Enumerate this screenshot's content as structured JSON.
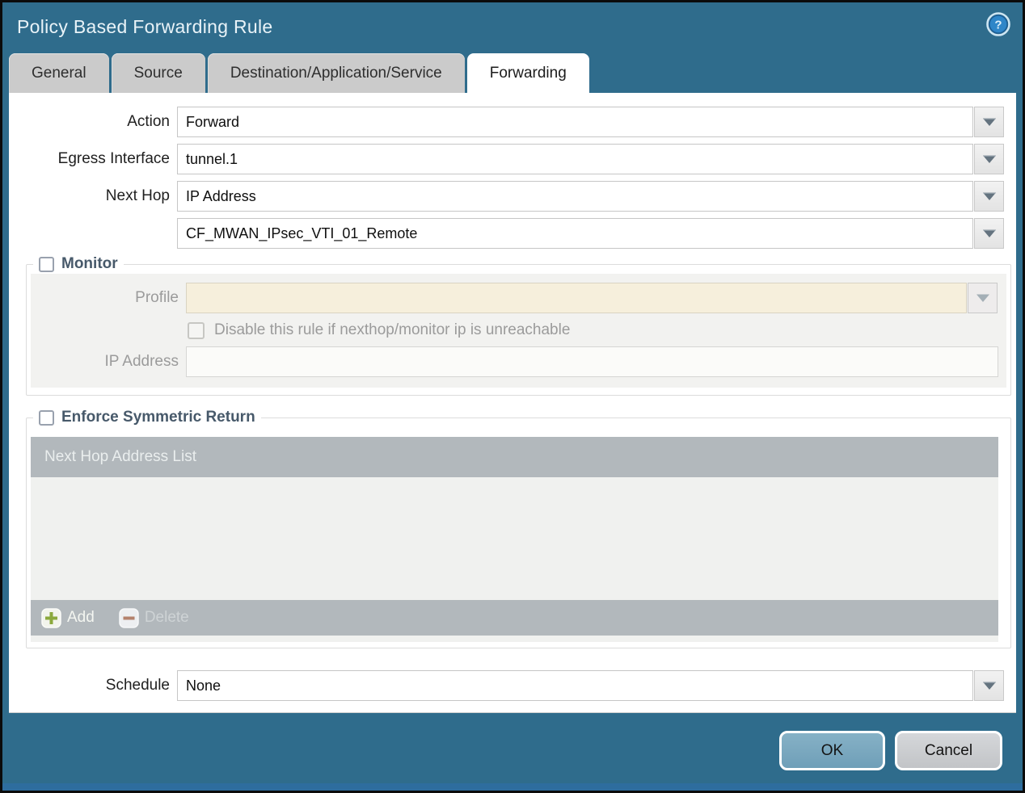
{
  "window": {
    "title": "Policy Based Forwarding Rule",
    "help_glyph": "?"
  },
  "tabs": [
    {
      "label": "General"
    },
    {
      "label": "Source"
    },
    {
      "label": "Destination/Application/Service"
    },
    {
      "label": "Forwarding"
    }
  ],
  "form": {
    "action_label": "Action",
    "action_value": "Forward",
    "egress_label": "Egress Interface",
    "egress_value": "tunnel.1",
    "next_hop_label": "Next Hop",
    "next_hop_value": "IP Address",
    "next_hop_address_value": "CF_MWAN_IPsec_VTI_01_Remote",
    "schedule_label": "Schedule",
    "schedule_value": "None"
  },
  "monitor": {
    "legend": "Monitor",
    "checked": false,
    "profile_label": "Profile",
    "profile_value": "",
    "disable_label": "Disable this rule if nexthop/monitor ip is unreachable",
    "disable_checked": false,
    "ip_label": "IP Address",
    "ip_value": ""
  },
  "symmetric": {
    "legend": "Enforce Symmetric Return",
    "checked": false,
    "table_header": "Next Hop Address List",
    "rows": [],
    "add_label": "Add",
    "delete_label": "Delete"
  },
  "buttons": {
    "ok": "OK",
    "cancel": "Cancel"
  },
  "icons": {
    "help": "help-icon",
    "dropdown": "chevron-down-icon",
    "add": "plus-icon",
    "delete": "minus-icon"
  },
  "colors": {
    "titlebar": "#2f6c8c",
    "table_header": "#b2b8bc",
    "profile_disabled_bg": "#f6efdc",
    "ok_button": "#7baac1",
    "bottom_strip": "#2e6d9e"
  }
}
